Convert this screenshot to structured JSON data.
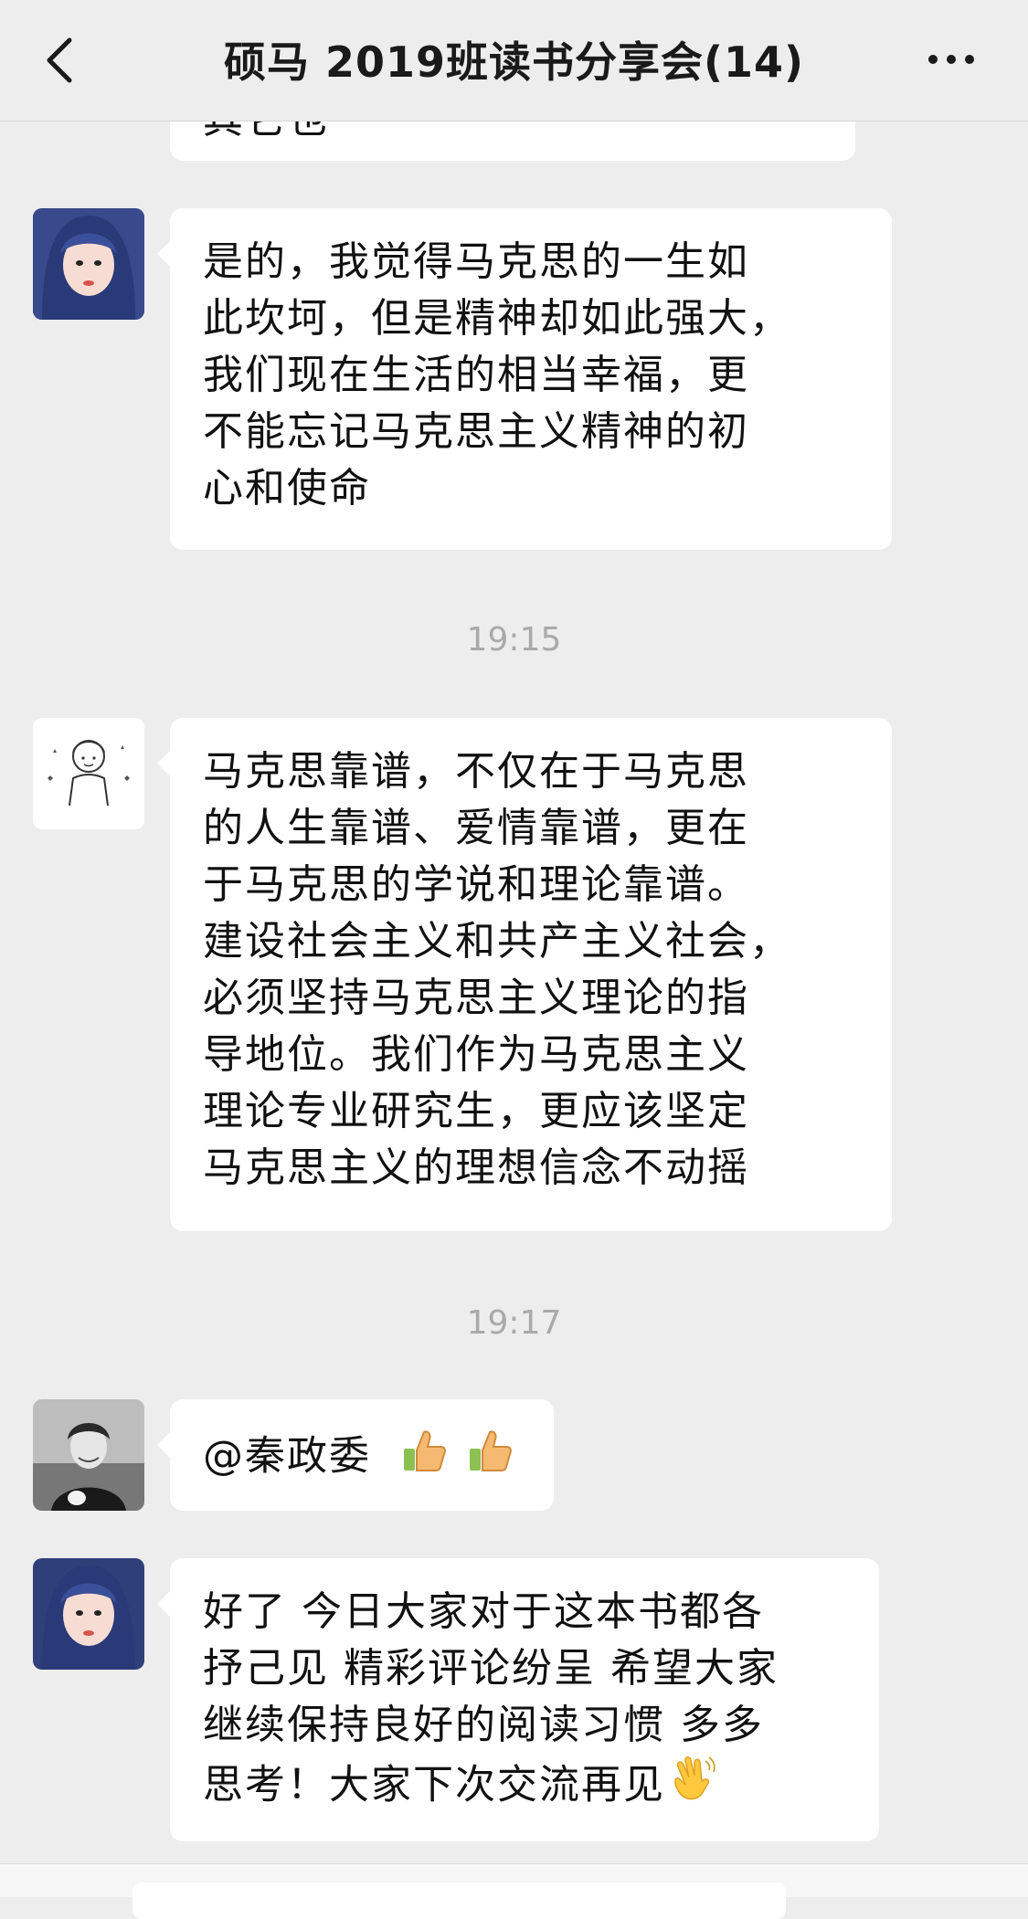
{
  "header": {
    "title": "硕马 2019班读书分享会(14)"
  },
  "messages": [
    {
      "sender": "avatar-girl-blue-hair",
      "lines": [
        "其它也"
      ]
    },
    {
      "sender": "avatar-girl-blue-hair",
      "lines": [
        "是的，我觉得马克思的一生如",
        "此坎坷，但是精神却如此强大，",
        "我们现在生活的相当幸福，更",
        "不能忘记马克思主义精神的初",
        "心和使命"
      ]
    },
    {
      "timestamp": "19:15"
    },
    {
      "sender": "avatar-cartoon-boy",
      "lines": [
        "马克思靠谱，不仅在于马克思",
        "的人生靠谱、爱情靠谱，更在",
        "于马克思的学说和理论靠谱。",
        "建设社会主义和共产主义社会，",
        "必须坚持马克思主义理论的指",
        "导地位。我们作为马克思主义",
        "理论专业研究生，更应该坚定",
        "马克思主义的理想信念不动摇"
      ]
    },
    {
      "timestamp": "19:17"
    },
    {
      "sender": "avatar-woman-bw",
      "text": "@秦政委",
      "emoji": [
        "thumbs-up",
        "thumbs-up"
      ]
    },
    {
      "sender": "avatar-girl-blue-hair",
      "lines": [
        "好了 今日大家对于这本书都各",
        "抒己见 精彩评论纷呈 希望大家",
        "继续保持良好的阅读习惯 多多",
        "思考！大家下次交流再见"
      ],
      "emoji": [
        "waving-hand"
      ]
    }
  ],
  "colors": {
    "background": "#ededed",
    "bubble": "#ffffff",
    "timestamp": "#a9a9a9",
    "text": "#111111"
  }
}
